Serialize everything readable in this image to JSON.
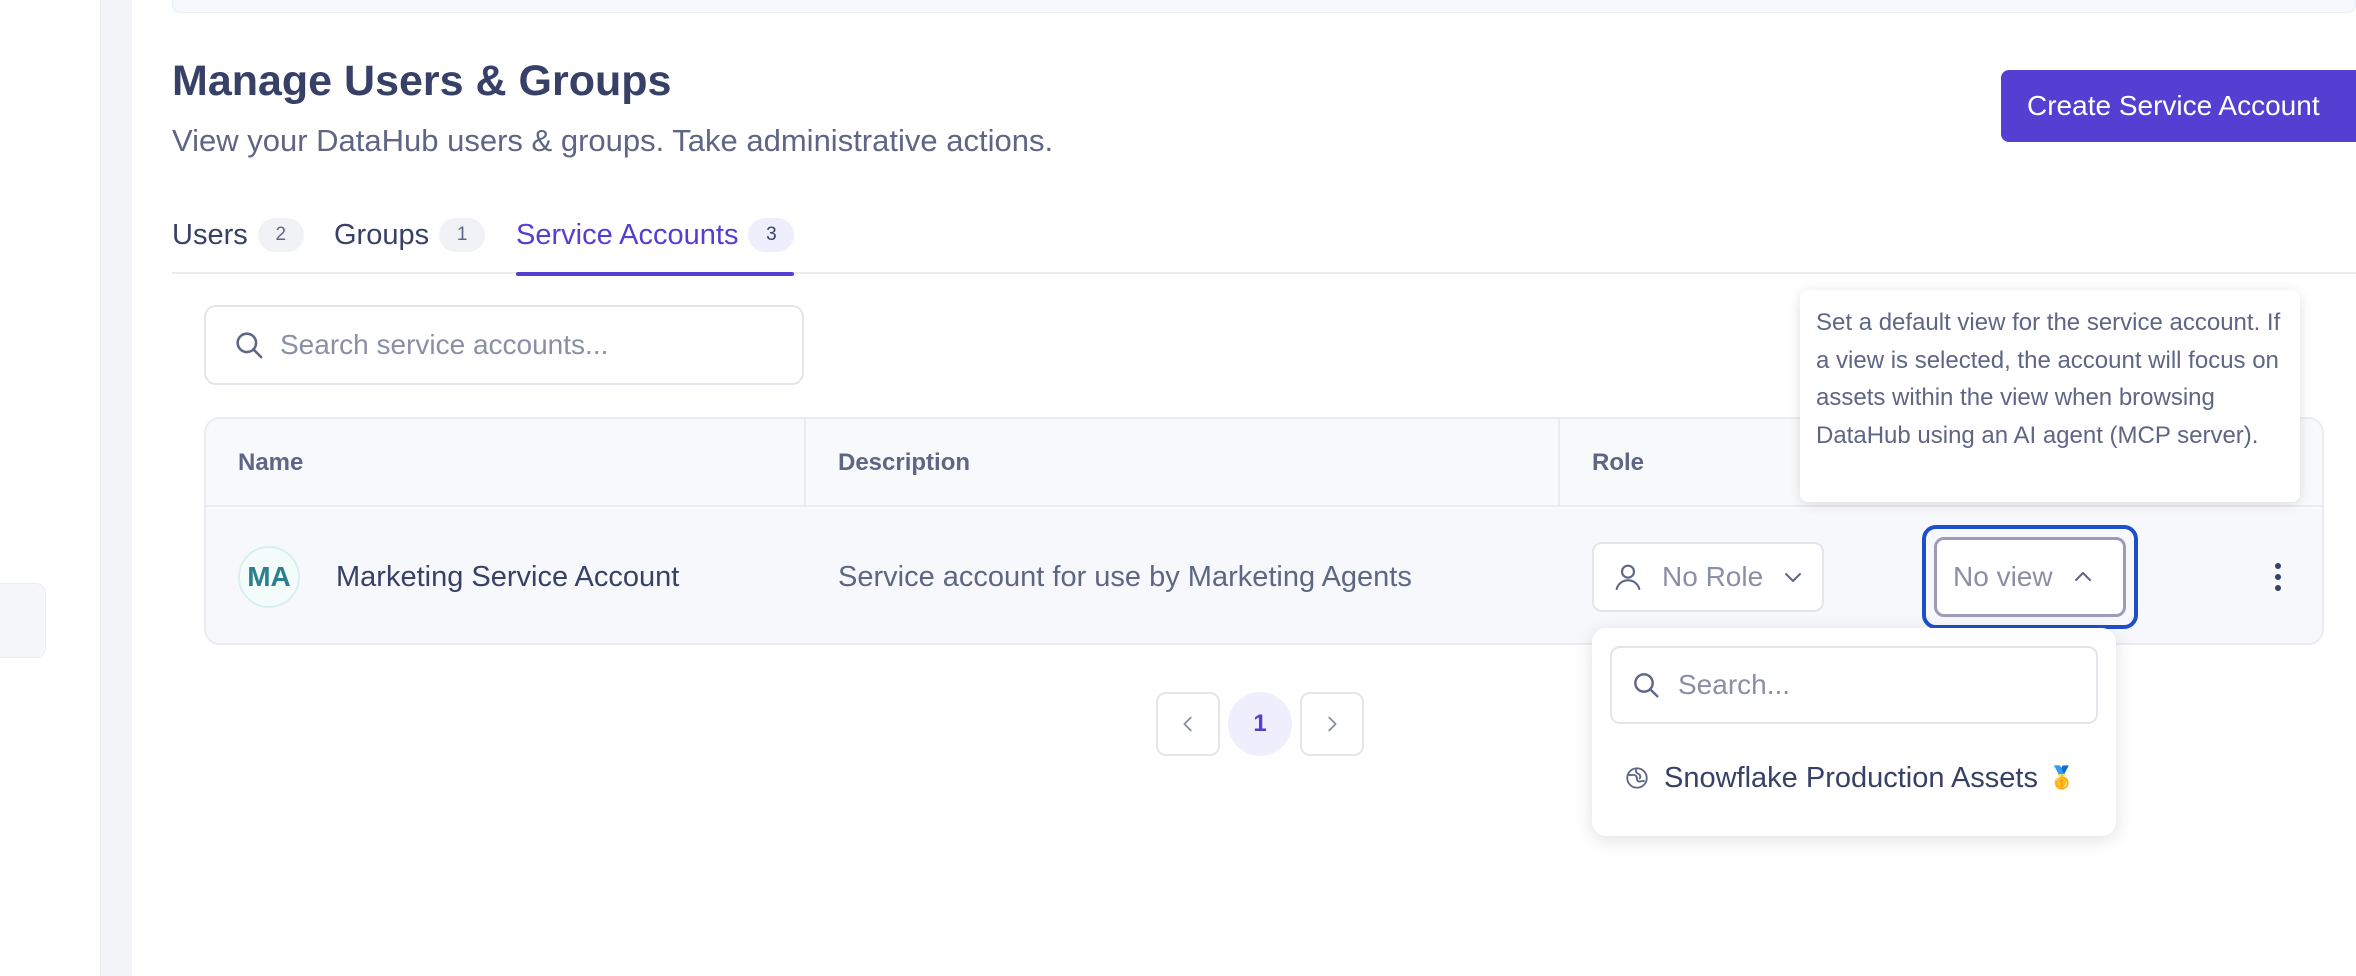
{
  "header": {
    "title": "Manage Users & Groups",
    "subtitle": "View your DataHub users & groups. Take administrative actions.",
    "create_button_label": "Create Service Account"
  },
  "tabs": [
    {
      "label": "Users",
      "count": "2",
      "active": false
    },
    {
      "label": "Groups",
      "count": "1",
      "active": false
    },
    {
      "label": "Service Accounts",
      "count": "3",
      "active": true
    }
  ],
  "search": {
    "placeholder": "Search service accounts...",
    "value": ""
  },
  "table": {
    "columns": [
      "Name",
      "Description",
      "Role"
    ],
    "rows": [
      {
        "avatar_initials": "MA",
        "name": "Marketing Service Account",
        "description": "Service account for use by Marketing Agents",
        "role": "No Role",
        "view": "No view"
      }
    ]
  },
  "tooltip": {
    "text": "Set a default view for the service account. If a view is selected, the account will focus on assets within the view when browsing DataHub using an AI agent (MCP server)."
  },
  "view_dropdown": {
    "search_placeholder": "Search...",
    "options": [
      {
        "label": "Snowflake Production Assets",
        "badge": "🥇"
      }
    ]
  },
  "pagination": {
    "current_page": "1",
    "prev_icon": "chevron-left-icon",
    "next_icon": "chevron-right-icon"
  },
  "colors": {
    "accent": "#533fd1",
    "focus_ring": "#1f4fc8",
    "text_primary": "#374066",
    "text_secondary": "#5f6685"
  }
}
